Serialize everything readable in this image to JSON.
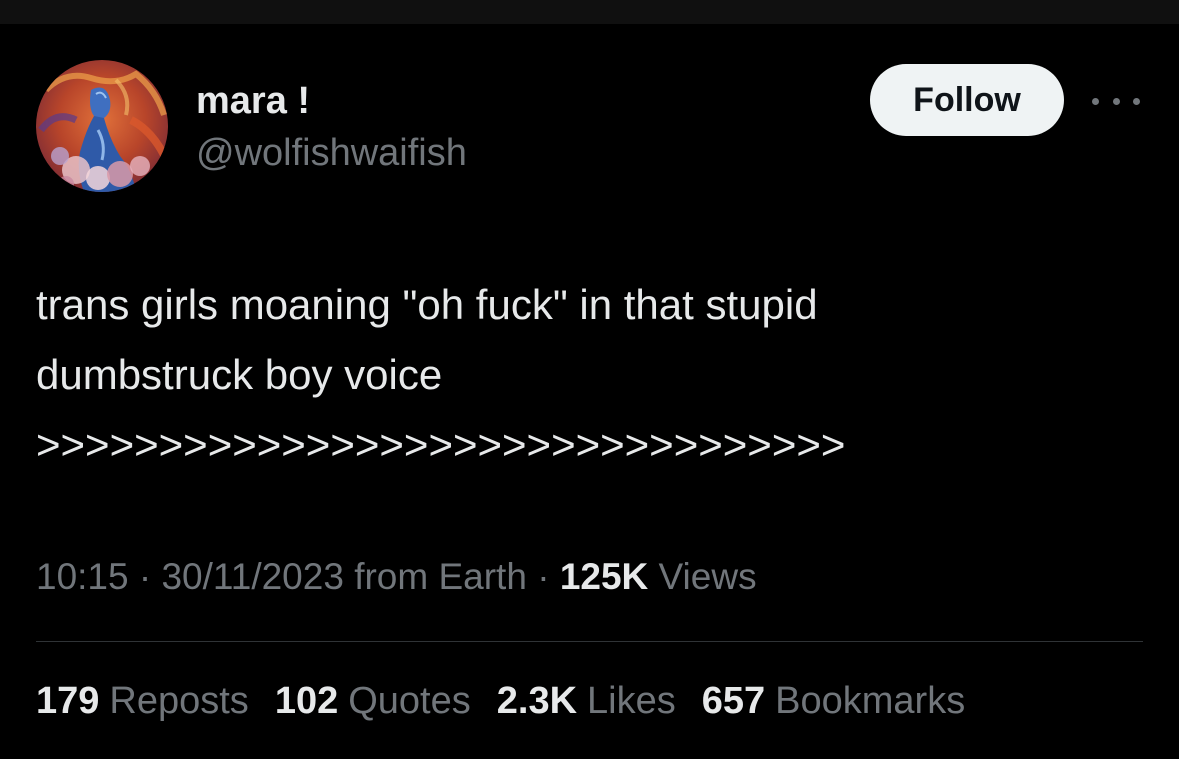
{
  "author": {
    "display_name": "mara !",
    "handle": "@wolfishwaifish",
    "avatar_icon": "painted-portrait-avatar"
  },
  "follow_button": {
    "label": "Follow"
  },
  "more_icon": "more-horizontal-icon",
  "tweet": {
    "lines": [
      "trans girls moaning \"oh fuck\" in that stupid",
      "dumbstruck boy voice",
      ">>>>>>>>>>>>>>>>>>>>>>>>>>>>>>>>>"
    ]
  },
  "meta": {
    "time": "10:15",
    "date": "30/11/2023",
    "source": "from Earth",
    "sep": "·",
    "views_count": "125K",
    "views_label": "Views"
  },
  "stats": [
    {
      "count": "179",
      "label": "Reposts"
    },
    {
      "count": "102",
      "label": "Quotes"
    },
    {
      "count": "2.3K",
      "label": "Likes"
    },
    {
      "count": "657",
      "label": "Bookmarks"
    }
  ],
  "colors": {
    "background": "#000000",
    "text_primary": "#e7e9ea",
    "text_secondary": "#71767b",
    "divider": "#2f3336",
    "follow_bg": "#eff3f4"
  }
}
